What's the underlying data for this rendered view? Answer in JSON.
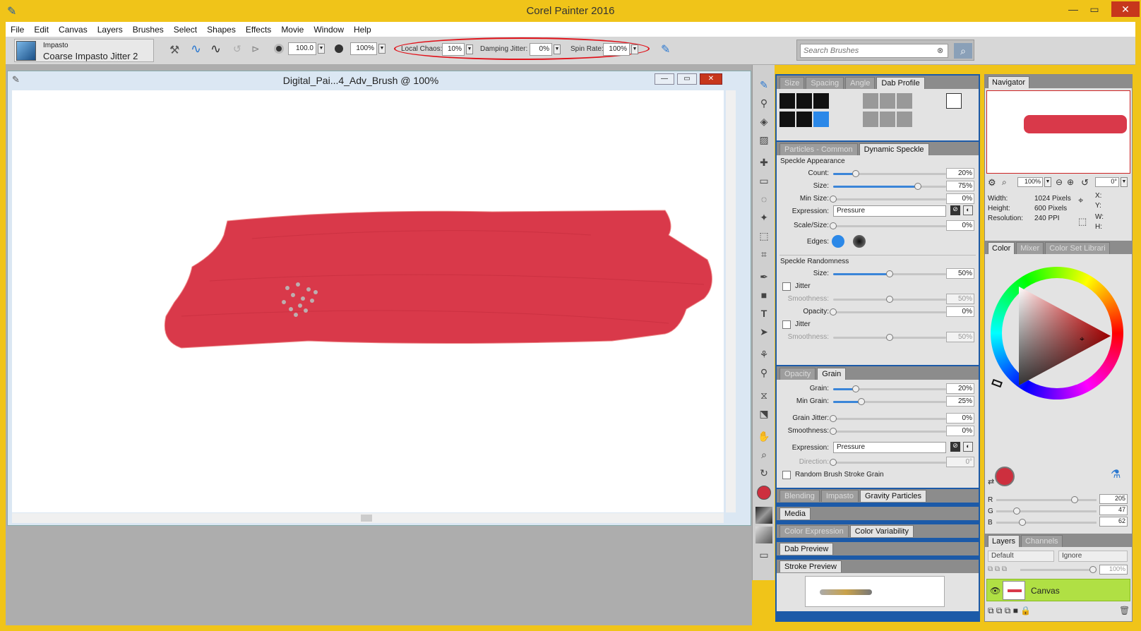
{
  "app": {
    "title": "Corel Painter 2016"
  },
  "menu": [
    "File",
    "Edit",
    "Canvas",
    "Layers",
    "Brushes",
    "Select",
    "Shapes",
    "Effects",
    "Movie",
    "Window",
    "Help"
  ],
  "brush": {
    "category": "Impasto",
    "variant": "Coarse Impasto Jitter 2"
  },
  "propbar": {
    "size_value": "100.0",
    "opacity_value": "100%",
    "local_chaos_label": "Local Chaos:",
    "local_chaos_value": "10%",
    "damping_jitter_label": "Damping Jitter:",
    "damping_jitter_value": "0%",
    "spin_rate_label": "Spin Rate:",
    "spin_rate_value": "100%",
    "search_placeholder": "Search Brushes",
    "highlight_color": "#e0121a"
  },
  "document": {
    "title": "Digital_Pai...4_Adv_Brush @ 100%",
    "stroke_color": "#d9394a"
  },
  "brush_panel": {
    "tabs_top": [
      "Size",
      "Spacing",
      "Angle",
      "Dab Profile"
    ],
    "tabs_particles": [
      "Particles - Common",
      "Dynamic Speckle"
    ],
    "speckle_appearance": {
      "title": "Speckle Appearance",
      "count_label": "Count:",
      "count_value": "20%",
      "count_level": 0.2,
      "size_label": "Size:",
      "size_value": "75%",
      "size_level": 0.75,
      "min_size_label": "Min Size:",
      "min_size_value": "0%",
      "expression_label": "Expression:",
      "expression_value": "Pressure",
      "scale_size_label": "Scale/Size:",
      "scale_size_value": "0%",
      "edges_label": "Edges:"
    },
    "speckle_randomness": {
      "title": "Speckle Randomness",
      "size_label": "Size:",
      "size_value": "50%",
      "size_level": 0.5,
      "jitter_label": "Jitter",
      "smoothness_label": "Smoothness:",
      "smoothness_value": "50%",
      "opacity_label": "Opacity:",
      "opacity_value": "0%",
      "jitter2_label": "Jitter",
      "smoothness2_label": "Smoothness:",
      "smoothness2_value": "50%"
    },
    "tabs_grain": [
      "Opacity",
      "Grain"
    ],
    "grain": {
      "grain_label": "Grain:",
      "grain_value": "20%",
      "grain_level": 0.2,
      "min_grain_label": "Min Grain:",
      "min_grain_value": "25%",
      "min_grain_level": 0.25,
      "grain_jitter_label": "Grain Jitter:",
      "grain_jitter_value": "0%",
      "smoothness_label": "Smoothness:",
      "smoothness_value": "0%",
      "expression_label": "Expression:",
      "expression_value": "Pressure",
      "direction_label": "Direction:",
      "direction_value": "0°",
      "random_label": "Random Brush Stroke Grain"
    },
    "tabs_blend": [
      "Blending",
      "Impasto",
      "Gravity Particles"
    ],
    "media_label": "Media",
    "tabs_color": [
      "Color Expression",
      "Color Variability"
    ],
    "dab_preview_label": "Dab Preview",
    "stroke_preview_label": "Stroke Preview"
  },
  "navigator": {
    "tab": "Navigator",
    "zoom_value": "100%",
    "rotation_value": "0°",
    "width_label": "Width:",
    "width_value": "1024 Pixels",
    "height_label": "Height:",
    "height_value": "600 Pixels",
    "resolution_label": "Resolution:",
    "resolution_value": "240 PPI",
    "x_label": "X:",
    "y_label": "Y:",
    "w_label": "W:",
    "h_label": "H:"
  },
  "color": {
    "tabs": [
      "Color",
      "Mixer",
      "Color Set Librari"
    ],
    "r_label": "R",
    "r_value": "205",
    "g_label": "G",
    "g_value": "47",
    "b_label": "B",
    "b_value": "62",
    "current_hex": "#cd2f3e"
  },
  "layers": {
    "tabs": [
      "Layers",
      "Channels"
    ],
    "composite": "Default",
    "method": "Ignore",
    "opacity": "100%",
    "layer_name": "Canvas"
  }
}
